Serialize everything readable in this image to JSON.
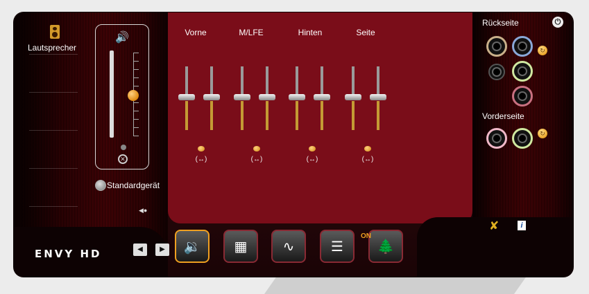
{
  "nav": {
    "speakers_label": "Lautsprecher"
  },
  "volume": {
    "default_label": "Standardgerät"
  },
  "channels": [
    {
      "label": "Vorne"
    },
    {
      "label": "M/LFE"
    },
    {
      "label": "Hinten"
    },
    {
      "label": "Seite"
    }
  ],
  "balance_icon": "(↔)",
  "jacks": {
    "back_label": "Rückseite",
    "front_label": "Vorderseite"
  },
  "logo": "ENVY HD",
  "mode_buttons": {
    "on_badge": "ON"
  },
  "icons": {
    "speaker": "speaker-icon",
    "volume": "speaker-volume-icon",
    "mute": "mute-icon",
    "power": "power-icon",
    "tools": "wrench-screwdriver-icon",
    "info": "info-icon"
  },
  "colors": {
    "accent": "#f0a020",
    "panel": "#7a0d19",
    "frame": "#1a0406"
  }
}
